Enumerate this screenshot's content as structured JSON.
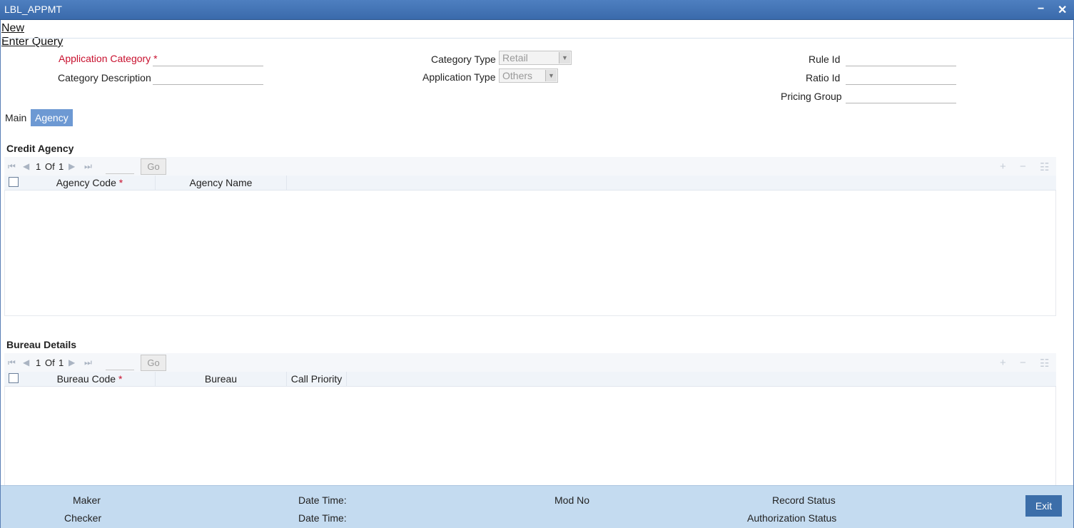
{
  "window": {
    "title": "LBL_APPMT",
    "minimize_label": "−",
    "close_label": "✕"
  },
  "actions": {
    "new_label": "New",
    "enter_query_label": "Enter Query"
  },
  "form": {
    "application_category_label": "Application Category",
    "application_category_required": "*",
    "application_category_value": "",
    "category_description_label": "Category Description",
    "category_description_value": "",
    "category_type_label": "Category Type",
    "category_type_value": "Retail",
    "application_type_label": "Application Type",
    "application_type_value": "Others",
    "rule_id_label": "Rule Id",
    "rule_id_value": "",
    "ratio_id_label": "Ratio Id",
    "ratio_id_value": "",
    "pricing_group_label": "Pricing Group",
    "pricing_group_value": ""
  },
  "tabs": [
    {
      "label": "Main",
      "active": false
    },
    {
      "label": "Agency",
      "active": true
    }
  ],
  "credit_agency": {
    "title": "Credit Agency",
    "page_current": "1",
    "page_of": "Of",
    "page_total": "1",
    "go_label": "Go",
    "columns": [
      "Agency Code",
      "Agency Name"
    ],
    "required_marker": "*"
  },
  "bureau_details": {
    "title": "Bureau Details",
    "page_current": "1",
    "page_of": "Of",
    "page_total": "1",
    "go_label": "Go",
    "columns": [
      "Bureau Code",
      "Bureau",
      "Call Priority"
    ],
    "required_marker": "*"
  },
  "footer": {
    "maker_label": "Maker",
    "checker_label": "Checker",
    "date_time_label_1": "Date Time:",
    "date_time_label_2": "Date Time:",
    "mod_no_label": "Mod No",
    "record_status_label": "Record Status",
    "authorization_status_label": "Authorization Status",
    "exit_label": "Exit"
  },
  "icons": {
    "first": "first-page-icon",
    "prev": "prev-page-icon",
    "next": "next-page-icon",
    "last": "last-page-icon",
    "add": "add-row-icon",
    "delete": "delete-row-icon",
    "view": "single-view-icon"
  },
  "colors": {
    "titlebar": "#3f6fb0",
    "active_tab": "#6d99d3",
    "footer": "#c4dbf0",
    "exit_button": "#3c6ea9",
    "required": "#c8102e"
  }
}
